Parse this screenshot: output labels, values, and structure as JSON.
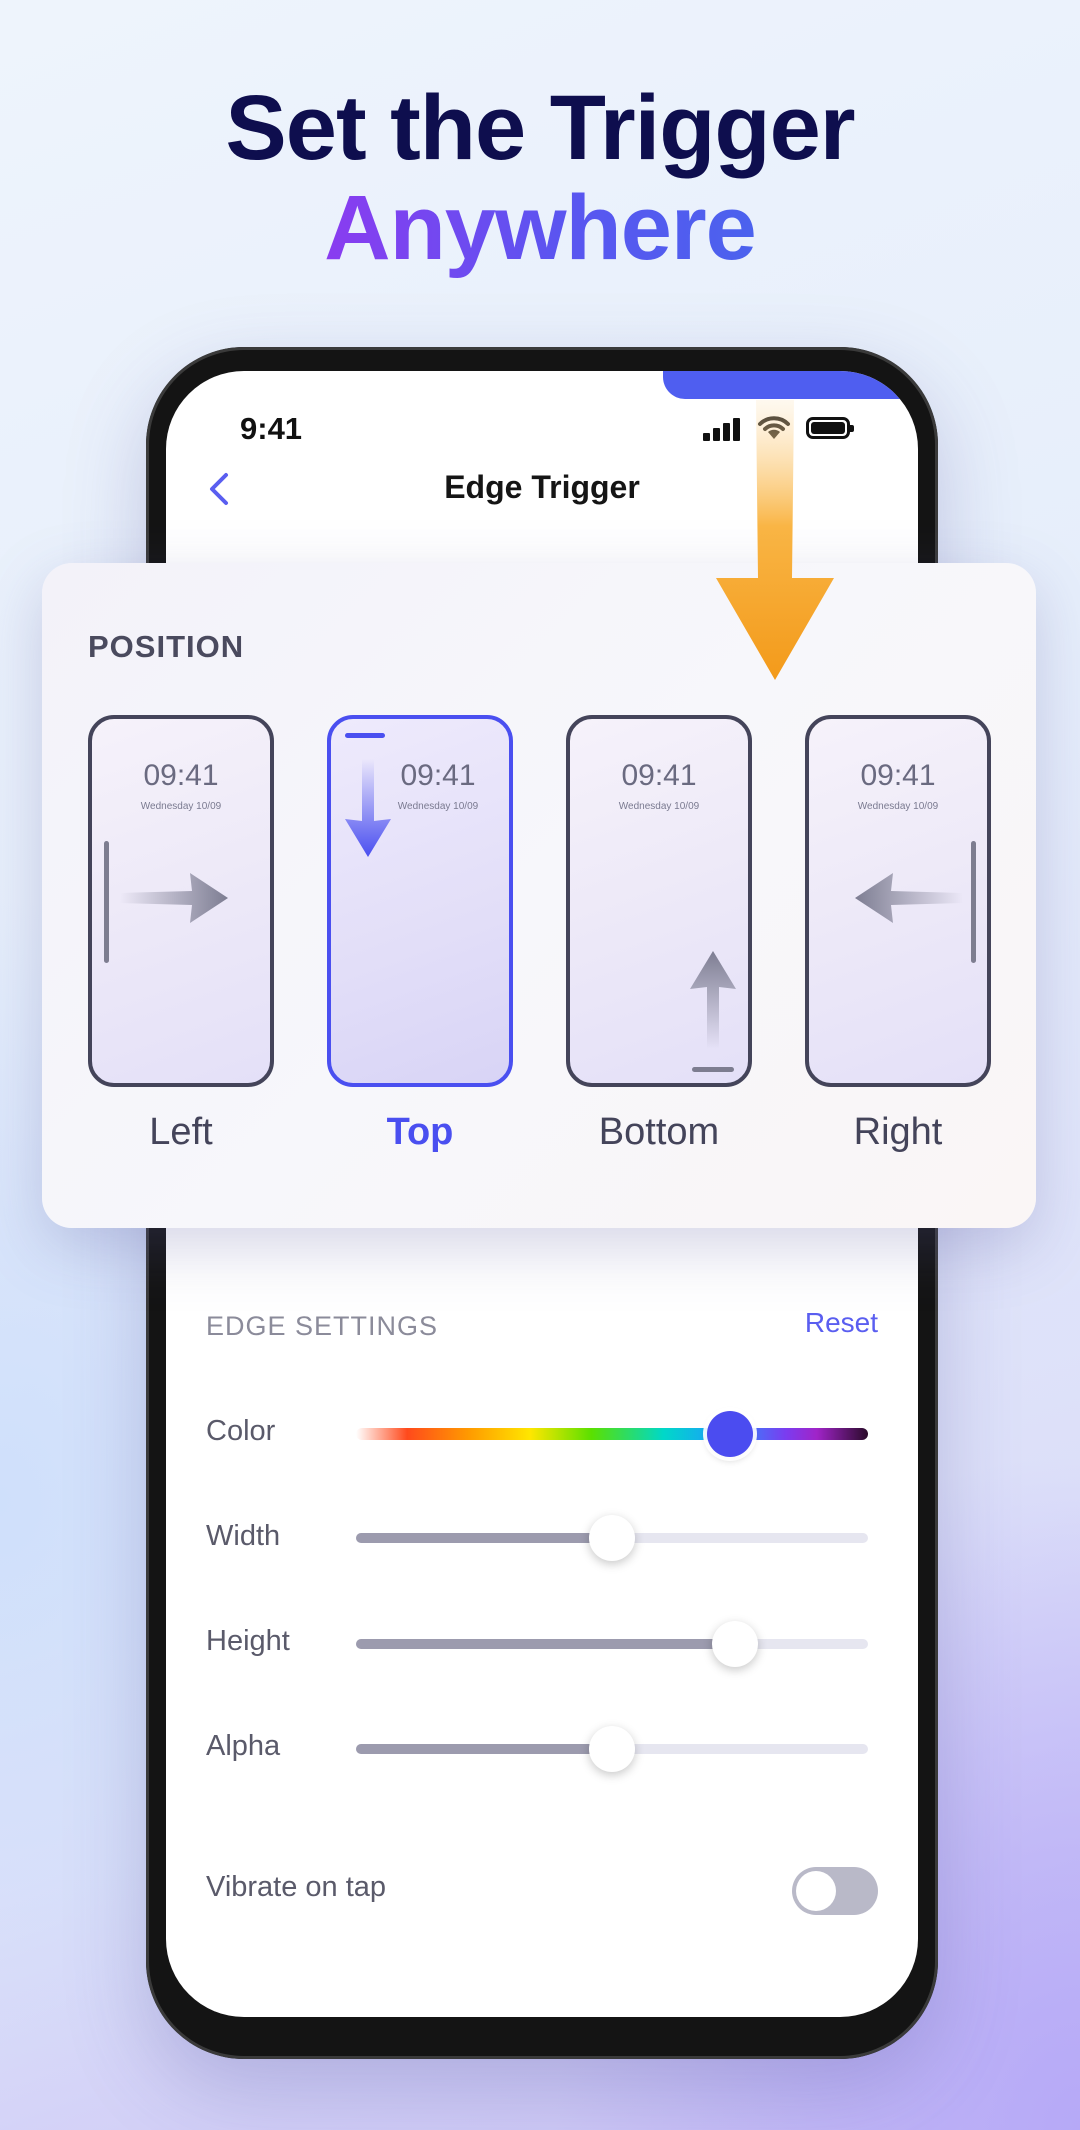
{
  "headline": {
    "line1": "Set the Trigger",
    "line2": "Anywhere"
  },
  "status_bar": {
    "time": "9:41",
    "icons": [
      "signal-icon",
      "wifi-icon",
      "battery-icon"
    ]
  },
  "nav": {
    "back_icon": "chevron-left-icon",
    "title": "Edge Trigger"
  },
  "position_card": {
    "title": "POSITION",
    "selected": "Top",
    "options": [
      {
        "label": "Left",
        "time": "09:41",
        "date": "Wednesday  10/09",
        "arrow": "right"
      },
      {
        "label": "Top",
        "time": "09:41",
        "date": "Wednesday  10/09",
        "arrow": "down"
      },
      {
        "label": "Bottom",
        "time": "09:41",
        "date": "Wednesday  10/09",
        "arrow": "up"
      },
      {
        "label": "Right",
        "time": "09:41",
        "date": "Wednesday  10/09",
        "arrow": "left"
      }
    ]
  },
  "edge_settings": {
    "title": "EDGE SETTINGS",
    "reset_label": "Reset",
    "sliders": [
      {
        "label": "Color",
        "value_fraction": 0.73
      },
      {
        "label": "Width",
        "value_fraction": 0.5
      },
      {
        "label": "Height",
        "value_fraction": 0.74
      },
      {
        "label": "Alpha",
        "value_fraction": 0.5
      }
    ],
    "vibrate": {
      "label": "Vibrate on tap",
      "on": false
    }
  },
  "colors": {
    "accent": "#4a4ff0",
    "headline_dark": "#0e0e4e",
    "headline_gradient": [
      "#8a3cf0",
      "#4b62ee"
    ],
    "arrow": "#f7a52a"
  }
}
